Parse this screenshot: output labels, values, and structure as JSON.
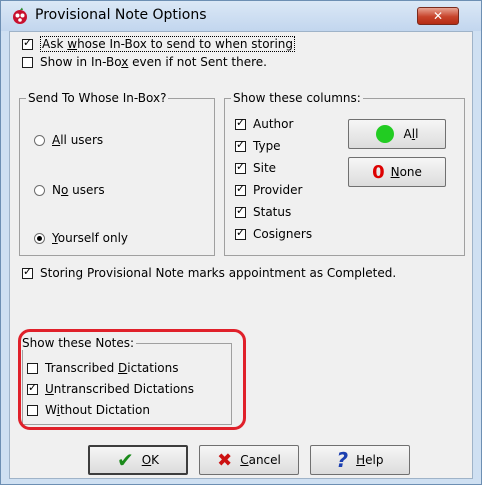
{
  "window": {
    "title": "Provisional Note Options",
    "close_glyph": "✕"
  },
  "options": {
    "ask_whose_inbox": {
      "pre": "Ask ",
      "key": "w",
      "post": "hose In-Box to send to when storing",
      "checked": true
    },
    "show_in_inbox": {
      "pre": "Show in In-Bo",
      "key": "x",
      "post": " even if not Sent there.",
      "checked": false
    },
    "storing_marks_completed": {
      "label": "Storing Provisional Note marks appointment as Completed.",
      "checked": true
    }
  },
  "send_to": {
    "legend": "Send To Whose In-Box?",
    "radios": [
      {
        "key": "A",
        "post": "ll users",
        "selected": false
      },
      {
        "pre": "N",
        "key": "o",
        "post": " users",
        "selected": false
      },
      {
        "key": "Y",
        "post": "ourself only",
        "selected": true
      }
    ]
  },
  "columns": {
    "legend": "Show these columns:",
    "items": [
      {
        "label": "Author",
        "checked": true
      },
      {
        "label": "Type",
        "checked": true
      },
      {
        "label": "Site",
        "checked": true
      },
      {
        "label": "Provider",
        "checked": true
      },
      {
        "label": "Status",
        "checked": true
      },
      {
        "label": "Cosigners",
        "checked": true
      }
    ],
    "all_button": {
      "pre": "A",
      "key": "l",
      "post": "l",
      "icon_color": "#22cc22"
    },
    "none_button": {
      "icon_glyph": "0",
      "key": "N",
      "post": "one",
      "icon_color": "#dd0000"
    }
  },
  "notes": {
    "legend": "Show these Notes:",
    "items": [
      {
        "pre": "Transcribed ",
        "key": "D",
        "post": "ictations",
        "checked": false
      },
      {
        "key": "U",
        "post": "ntranscribed Dictations",
        "checked": true
      },
      {
        "pre": "W",
        "key": "i",
        "post": "thout Dictation",
        "checked": false
      }
    ]
  },
  "buttons": {
    "ok": {
      "key": "O",
      "post": "K",
      "icon_glyph": "✔",
      "icon_color": "#1a8a1a"
    },
    "cancel": {
      "key": "C",
      "post": "ancel",
      "icon_glyph": "✖",
      "icon_color": "#cc1111"
    },
    "help": {
      "key": "H",
      "post": "elp",
      "icon_glyph": "?",
      "icon_color": "#1b3fb0"
    }
  },
  "check_glyph": "✓",
  "highlight_color": "#e0202a"
}
